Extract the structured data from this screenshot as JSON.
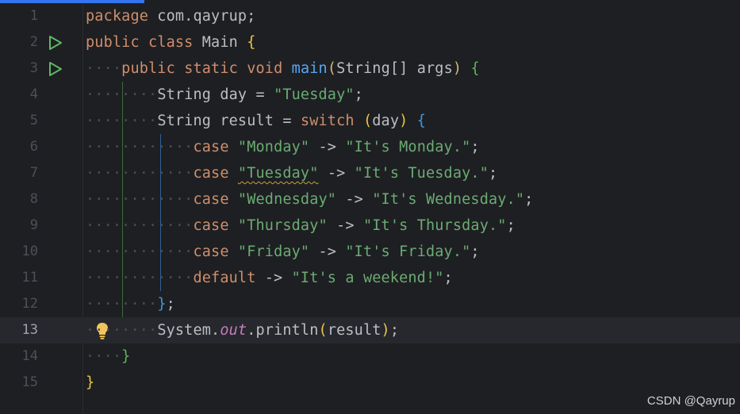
{
  "editor": {
    "current_line": 13,
    "lines": [
      {
        "num": "1"
      },
      {
        "num": "2"
      },
      {
        "num": "3"
      },
      {
        "num": "4"
      },
      {
        "num": "5"
      },
      {
        "num": "6"
      },
      {
        "num": "7"
      },
      {
        "num": "8"
      },
      {
        "num": "9"
      },
      {
        "num": "10"
      },
      {
        "num": "11"
      },
      {
        "num": "12"
      },
      {
        "num": "13"
      },
      {
        "num": "14"
      },
      {
        "num": "15"
      }
    ],
    "tokens": {
      "package_kw": "package",
      "package_name": " com.qayrup;",
      "public_kw": "public",
      "class_kw": "class",
      "class_name": " Main ",
      "brace_open": "{",
      "static_kw": "static",
      "void_kw": "void",
      "main_fn": "main",
      "main_params_open": "(",
      "main_params": "String[] args",
      "main_params_close": ")",
      "string_type": "String",
      "day_decl": " day = ",
      "tuesday_value": "\"Tuesday\"",
      "semicolon": ";",
      "result_decl": " result = ",
      "switch_kw": "switch",
      "paren_open": "(",
      "day_var": "day",
      "paren_close": ")",
      "case_kw": "case",
      "arrow": " -> ",
      "case1_label": "\"Monday\"",
      "case1_value": "\"It's Monday.\"",
      "case2_label": "\"Tuesday\"",
      "case2_value": "\"It's Tuesday.\"",
      "case3_label": "\"Wednesday\"",
      "case3_value": "\"It's Wednesday.\"",
      "case4_label": "\"Thursday\"",
      "case4_value": "\"It's Thursday.\"",
      "case5_label": "\"Friday\"",
      "case5_value": "\"It's Friday.\"",
      "default_kw": "default",
      "default_value": "\"It's a weekend!\"",
      "switch_close": "}",
      "system": "System.",
      "out_field": "out",
      "println": ".println",
      "result_var": "result",
      "brace_close": "}"
    }
  },
  "icons": {
    "run": "run-gutter-icon",
    "bulb": "lightbulb-intention-icon"
  },
  "colors": {
    "background": "#1e1f22",
    "current_line": "#26282e",
    "keyword": "#cf8e6d",
    "string": "#6aab73",
    "function": "#56a8f5",
    "static_field": "#c77dbb",
    "default_text": "#bcbec4",
    "run_icon": "#5fb865",
    "tab_indicator": "#3574f0"
  },
  "watermark": "CSDN @Qayrup"
}
